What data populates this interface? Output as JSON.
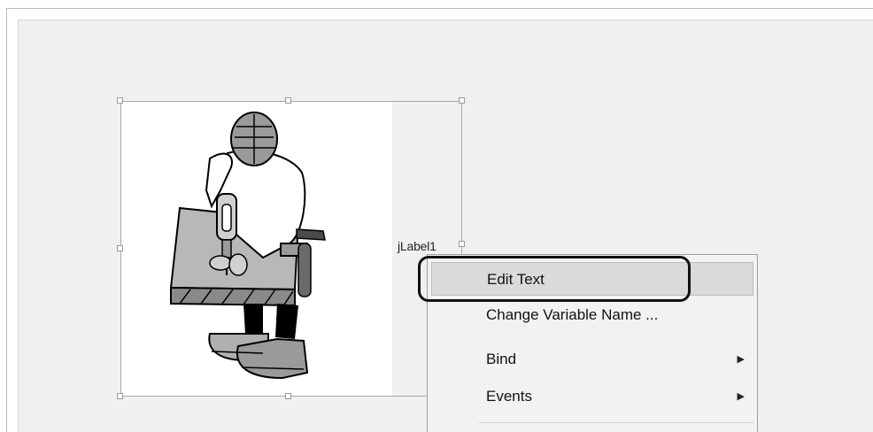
{
  "component": {
    "label_name": "jLabel1",
    "image_icon": "carpenter-drilling-icon"
  },
  "context_menu": {
    "items": [
      {
        "label": "Edit Text",
        "has_submenu": false,
        "highlighted": true
      },
      {
        "label": "Change Variable Name ...",
        "has_submenu": false,
        "highlighted": false
      },
      {
        "label": "Bind",
        "has_submenu": true,
        "highlighted": false
      },
      {
        "label": "Events",
        "has_submenu": true,
        "highlighted": false
      }
    ],
    "submenu_arrow_icon": "triangle-right-icon"
  },
  "colors": {
    "design_background": "#f0f0f0",
    "menu_highlight": "#dadada",
    "callout_border": "#111111"
  }
}
